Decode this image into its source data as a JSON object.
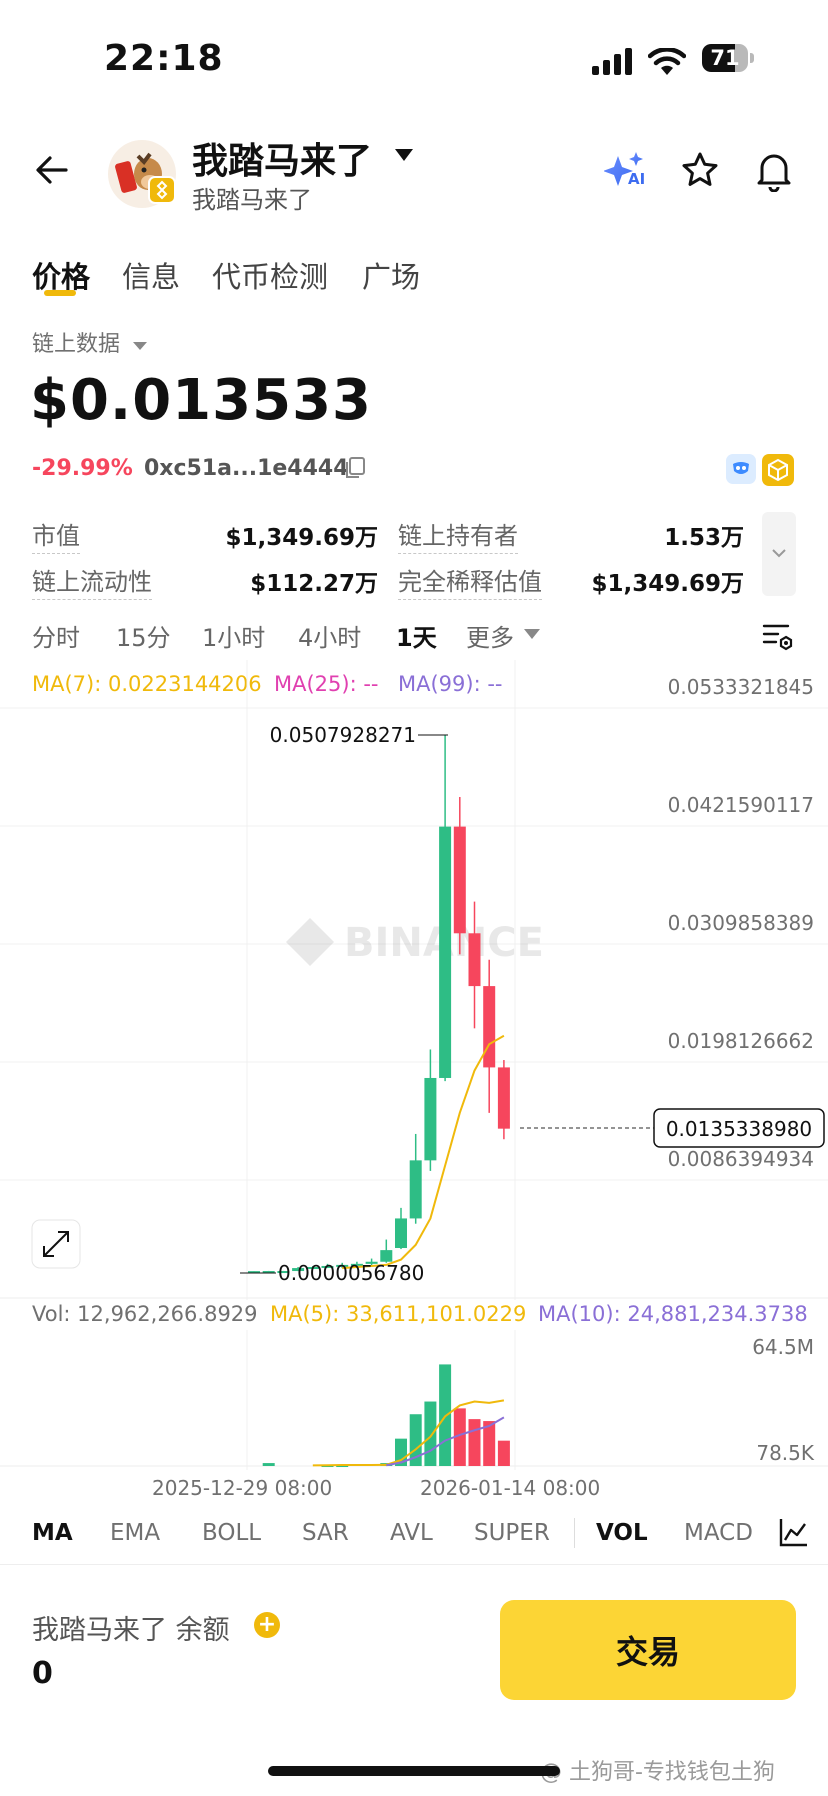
{
  "status_bar": {
    "time": "22:18",
    "battery": "71",
    "battery_level": 0.71
  },
  "header": {
    "title": "我踏马来了",
    "subtitle": "我踏马来了",
    "ai_label": "AI"
  },
  "tabs": [
    {
      "label": "价格",
      "active": true
    },
    {
      "label": "信息"
    },
    {
      "label": "代币检测"
    },
    {
      "label": "广场"
    }
  ],
  "data_source": "链上数据",
  "price": "$0.013533",
  "change": "-29.99%",
  "contract": "0xc51a...1e4444",
  "stats": [
    {
      "label": "市值",
      "value": "$1,349.69万"
    },
    {
      "label": "链上持有者",
      "value": "1.53万"
    },
    {
      "label": "链上流动性",
      "value": "$112.27万"
    },
    {
      "label": "完全稀释估值",
      "value": "$1,349.69万"
    }
  ],
  "intervals": [
    {
      "label": "分时"
    },
    {
      "label": "15分"
    },
    {
      "label": "1小时"
    },
    {
      "label": "4小时"
    },
    {
      "label": "1天",
      "active": true
    },
    {
      "label": "更多"
    }
  ],
  "chart": {
    "ma7": "MA(7): 0.0223144206",
    "ma25": "MA(25): --",
    "ma99": "MA(99): --",
    "high_label": "0.0507928271",
    "low_label": "0.0000056780",
    "current_label": "0.0135338980",
    "watermark": "BINANCE",
    "y_ticks": [
      "0.0533321845",
      "0.0421590117",
      "0.0309858389",
      "0.0198126662",
      "0.0086394934"
    ],
    "vol_text": "Vol: 12,962,266.8929",
    "vol_ma5": "MA(5): 33,611,101.0229",
    "vol_ma10": "MA(10): 24,881,234.3738",
    "vol_max": "64.5M",
    "vol_min": "78.5K",
    "x_ticks": [
      "2025-12-29 08:00",
      "2026-01-14 08:00"
    ],
    "colors": {
      "up": "#2ebd85",
      "down": "#f6465d",
      "ma7": "#f0b90b",
      "ma25": "#e040b0",
      "ma99": "#8a6fd6"
    }
  },
  "chart_data": {
    "type": "candlestick",
    "ylim": [
      0,
      0.0533321845
    ],
    "candles": [
      {
        "o": 5.678e-06,
        "h": 2e-05,
        "l": 5.678e-06,
        "c": 1e-05
      },
      {
        "o": 1e-05,
        "h": 3e-05,
        "l": 5e-06,
        "c": 2e-05
      },
      {
        "o": 2e-05,
        "h": 3e-05,
        "l": 1e-05,
        "c": 2e-05
      },
      {
        "o": 2e-05,
        "h": 0.0004,
        "l": 1e-05,
        "c": 0.0003
      },
      {
        "o": 0.0003,
        "h": 0.0005,
        "l": 0.0002,
        "c": 0.0004
      },
      {
        "o": 0.0004,
        "h": 0.0007,
        "l": 0.0003,
        "c": 0.0005
      },
      {
        "o": 0.0005,
        "h": 0.0008,
        "l": 0.0003,
        "c": 0.0006
      },
      {
        "o": 0.0006,
        "h": 0.0009,
        "l": 0.0004,
        "c": 0.0007
      },
      {
        "o": 0.0007,
        "h": 0.0012,
        "l": 0.0005,
        "c": 0.0009
      },
      {
        "o": 0.0009,
        "h": 0.003,
        "l": 0.0008,
        "c": 0.002
      },
      {
        "o": 0.0022,
        "h": 0.006,
        "l": 0.0021,
        "c": 0.005
      },
      {
        "o": 0.005,
        "h": 0.013,
        "l": 0.0045,
        "c": 0.0105
      },
      {
        "o": 0.0105,
        "h": 0.021,
        "l": 0.0095,
        "c": 0.0183
      },
      {
        "o": 0.0183,
        "h": 0.0508,
        "l": 0.018,
        "c": 0.0421
      },
      {
        "o": 0.0421,
        "h": 0.0449,
        "l": 0.03,
        "c": 0.032
      },
      {
        "o": 0.032,
        "h": 0.035,
        "l": 0.023,
        "c": 0.027
      },
      {
        "o": 0.027,
        "h": 0.0295,
        "l": 0.015,
        "c": 0.0193
      },
      {
        "o": 0.0193,
        "h": 0.02,
        "l": 0.0125,
        "c": 0.0135
      }
    ],
    "ma7": [
      null,
      null,
      null,
      null,
      null,
      null,
      0.0003,
      0.0004,
      0.0005,
      0.0006,
      0.0011,
      0.0025,
      0.005,
      0.01,
      0.015,
      0.019,
      0.0215,
      0.0223
    ],
    "volume": {
      "ylim": [
        0,
        64500000
      ],
      "up": [
        true,
        true,
        true,
        true,
        true,
        true,
        true,
        true,
        true,
        true,
        true,
        true,
        true,
        true,
        false,
        false,
        false,
        false
      ],
      "values": [
        0,
        1500000,
        0,
        0,
        0,
        500000,
        500000,
        0,
        0,
        1500000,
        14000000,
        26500000,
        33000000,
        52000000,
        29500000,
        24000000,
        23000000,
        12962266
      ],
      "ma5": [
        null,
        null,
        null,
        null,
        300000,
        400000,
        500000,
        500000,
        500000,
        600000,
        3000000,
        8500000,
        15000000,
        25400000,
        31000000,
        33000000,
        32300000,
        33611101
      ],
      "ma10": [
        null,
        null,
        null,
        null,
        null,
        null,
        null,
        null,
        null,
        400000,
        1800000,
        4500000,
        7800000,
        13000000,
        15900000,
        18300000,
        20500000,
        24881234
      ]
    }
  },
  "indicators": [
    {
      "label": "MA",
      "active": true
    },
    {
      "label": "EMA"
    },
    {
      "label": "BOLL"
    },
    {
      "label": "SAR"
    },
    {
      "label": "AVL"
    },
    {
      "label": "SUPER"
    },
    {
      "label": "VOL",
      "active": true
    },
    {
      "label": "MACD"
    }
  ],
  "balance": {
    "label": "我踏马来了 余额",
    "value": "0"
  },
  "trade_button": "交易",
  "watermark": "@ 土狗哥-专找钱包土狗"
}
